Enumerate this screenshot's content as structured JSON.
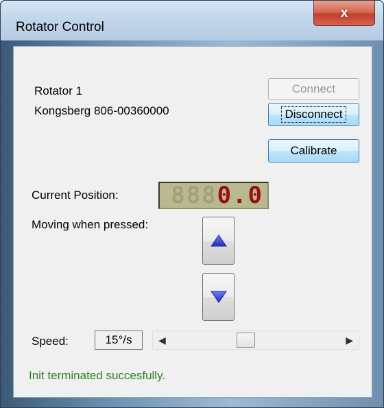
{
  "window": {
    "title": "Rotator Control",
    "close_label": "x"
  },
  "device": {
    "name": "Rotator 1",
    "model": "Kongsberg 806-00360000"
  },
  "buttons": {
    "connect": "Connect",
    "disconnect": "Disconnect",
    "calibrate": "Calibrate"
  },
  "position": {
    "label": "Current Position:",
    "ghost": "888",
    "value": "0.0"
  },
  "moving": {
    "label": "Moving when pressed:"
  },
  "speed": {
    "label": "Speed:",
    "value": "15°/s",
    "slider_fraction": 0.43
  },
  "status": {
    "text": "Init terminated succesfully."
  },
  "colors": {
    "status_green": "#2e7d23",
    "lcd_digit": "#9b0e0e",
    "arrow_blue": "#1f2fbf"
  }
}
